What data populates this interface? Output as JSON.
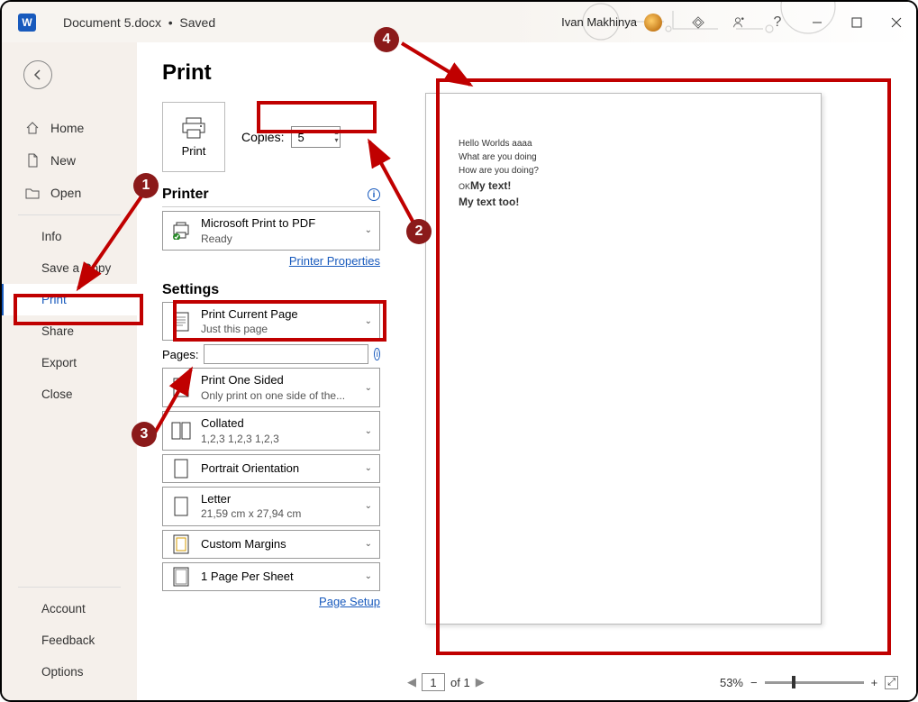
{
  "title": {
    "doc": "Document 5.docx",
    "state": "Saved"
  },
  "user": "Ivan Makhinya",
  "sidebar": {
    "home": "Home",
    "new": "New",
    "open": "Open",
    "info": "Info",
    "saveCopy": "Save a Copy",
    "print": "Print",
    "share": "Share",
    "export": "Export",
    "close": "Close",
    "account": "Account",
    "feedback": "Feedback",
    "options": "Options"
  },
  "print": {
    "heading": "Print",
    "printBtn": "Print",
    "copiesLabel": "Copies:",
    "copiesValue": "5",
    "printerHeading": "Printer",
    "printerName": "Microsoft Print to PDF",
    "printerStatus": "Ready",
    "printerProps": "Printer Properties",
    "settingsHeading": "Settings",
    "whatTitle": "Print Current Page",
    "whatSub": "Just this page",
    "pagesLabel": "Pages:",
    "sideTitle": "Print One Sided",
    "sideSub": "Only print on one side of the...",
    "collTitle": "Collated",
    "collSub": "1,2,3    1,2,3    1,2,3",
    "orient": "Portrait Orientation",
    "paperTitle": "Letter",
    "paperSub": "21,59 cm x 27,94 cm",
    "margins": "Custom Margins",
    "sheet": "1 Page Per Sheet",
    "pageSetup": "Page Setup"
  },
  "preview": {
    "l1": "Hello Worlds aaaa",
    "l2": "What are you doing",
    "l3": "How are you doing?",
    "l4pre": "OK",
    "l4": "My text!",
    "l5": "My text too!"
  },
  "footer": {
    "page": "1",
    "of": "of 1",
    "zoom": "53%"
  },
  "callouts": {
    "c1": "1",
    "c2": "2",
    "c3": "3",
    "c4": "4"
  }
}
